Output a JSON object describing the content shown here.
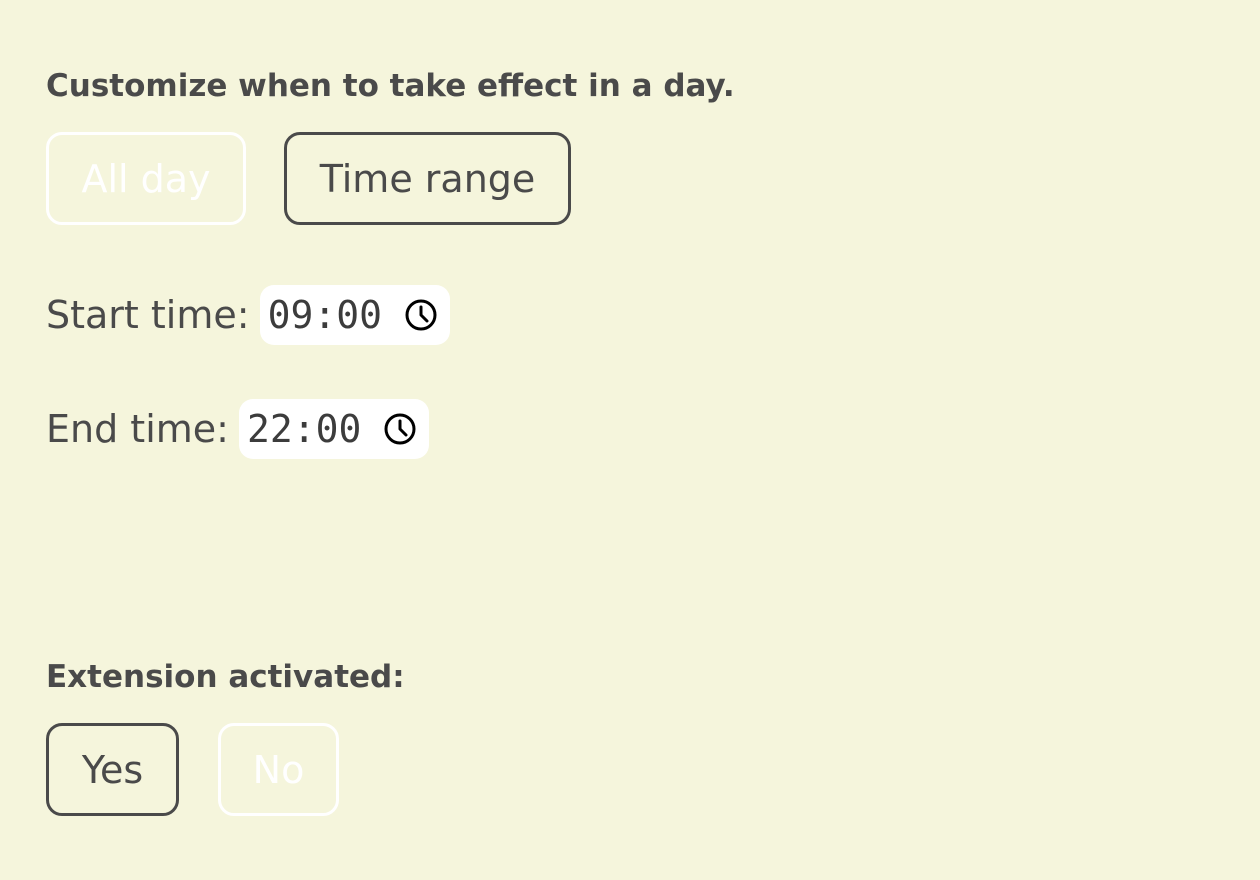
{
  "schedule": {
    "heading": "Customize when to take effect in a day.",
    "options": [
      {
        "label": "All day",
        "selected": false
      },
      {
        "label": "Time range",
        "selected": true
      }
    ],
    "start_label": "Start time:",
    "start_value": "09:00",
    "end_label": "End time:",
    "end_value": "22:00",
    "icon": "clock-icon"
  },
  "activation": {
    "heading": "Extension activated:",
    "options": [
      {
        "label": "Yes",
        "selected": true
      },
      {
        "label": "No",
        "selected": false
      }
    ]
  },
  "colors": {
    "background": "#f5f5dc",
    "text": "#4a4a4a",
    "inactive": "#ffffff"
  }
}
